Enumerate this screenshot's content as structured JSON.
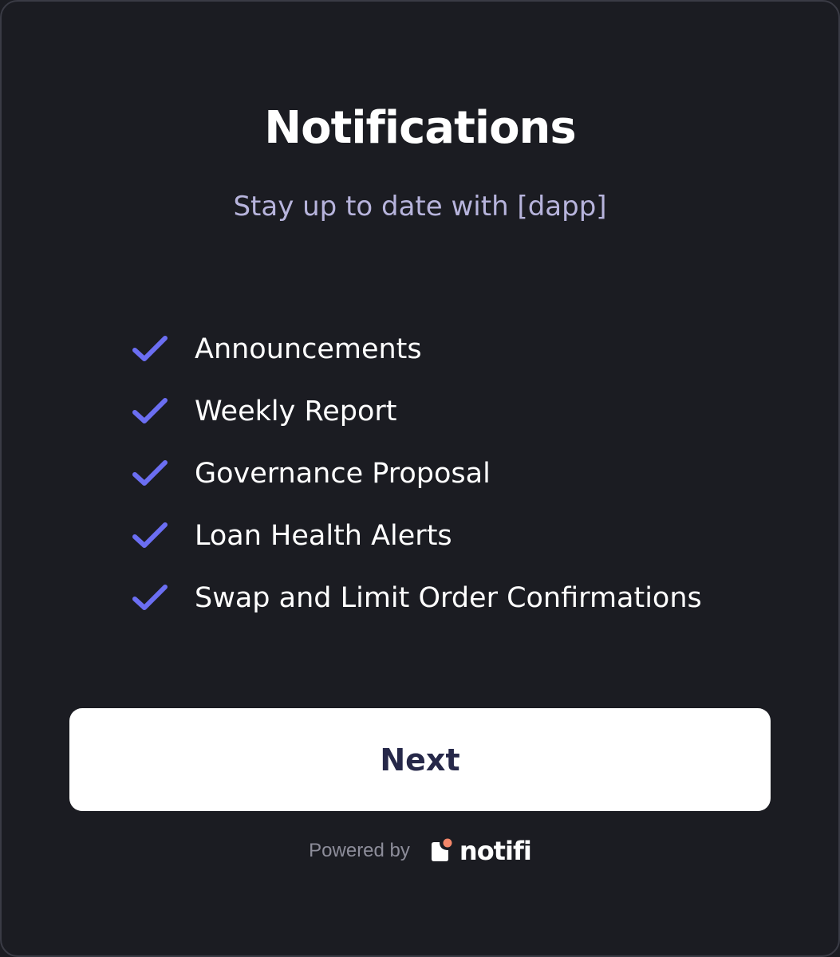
{
  "header": {
    "title": "Notifications",
    "subtitle": "Stay up to date with [dapp]"
  },
  "features": [
    {
      "label": "Announcements",
      "icon": "check-icon"
    },
    {
      "label": "Weekly Report",
      "icon": "check-icon"
    },
    {
      "label": "Governance Proposal",
      "icon": "check-icon"
    },
    {
      "label": "Loan Health Alerts",
      "icon": "check-icon"
    },
    {
      "label": "Swap and Limit Order Confirmations",
      "icon": "check-icon"
    }
  ],
  "actions": {
    "next_label": "Next"
  },
  "footer": {
    "powered_by": "Powered by",
    "brand": "notifi",
    "brand_icon": "notifi-logo-icon"
  },
  "colors": {
    "background": "#1b1c22",
    "accent_check": "#6b6ef2",
    "subtitle": "#b7b4dc",
    "button_bg": "#ffffff",
    "button_text": "#262849",
    "logo_dot": "#f4876a"
  }
}
